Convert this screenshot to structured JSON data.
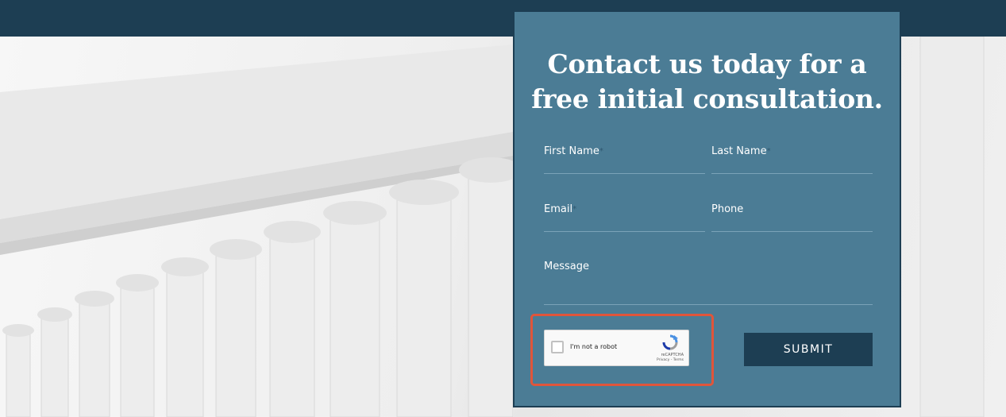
{
  "contact": {
    "headline": "Contact us today for a free initial consultation.",
    "required_marker": "*",
    "fields": {
      "first_name": "First Name",
      "last_name": "Last Name",
      "email": "Email",
      "phone": "Phone",
      "message": "Message"
    },
    "captcha": {
      "label": "I'm not a robot",
      "brand": "reCAPTCHA",
      "links": "Privacy - Terms"
    },
    "submit_label": "SUBMIT"
  },
  "colors": {
    "header_bar": "#1d3e53",
    "panel": "#4b7c95",
    "button": "#1d3e53",
    "highlight": "#e0553a"
  }
}
